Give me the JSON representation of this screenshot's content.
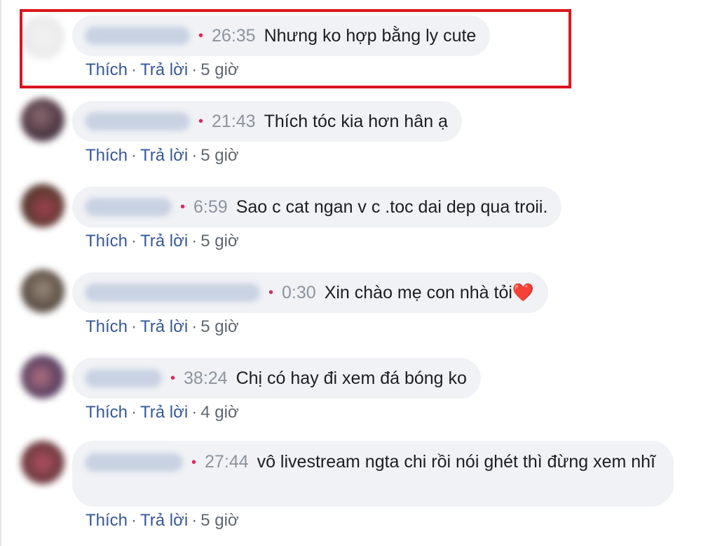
{
  "comments": [
    {
      "time": "26:35",
      "text": "Nhưng ko hợp bằng ly cute",
      "like": "Thích",
      "reply": "Trả lời",
      "age": "5 giờ"
    },
    {
      "time": "21:43",
      "text": "Thích tóc kia hơn hân ạ",
      "like": "Thích",
      "reply": "Trả lời",
      "age": "5 giờ"
    },
    {
      "time": "6:59",
      "text": "Sao c cat ngan v c .toc dai dep qua troii.",
      "like": "Thích",
      "reply": "Trả lời",
      "age": "5 giờ"
    },
    {
      "time": "0:30",
      "text": "Xin chào mẹ con nhà tỏi",
      "emoji": "❤️",
      "like": "Thích",
      "reply": "Trả lời",
      "age": "5 giờ"
    },
    {
      "time": "38:24",
      "text": "Chị có hay đi xem đá bóng ko",
      "like": "Thích",
      "reply": "Trả lời",
      "age": "4 giờ"
    },
    {
      "time": "27:44",
      "text": "vô livestream ngta chi rồi nói ghét thì đừng xem nhĩ",
      "like": "Thích",
      "reply": "Trả lời",
      "age": "5 giờ"
    }
  ],
  "separator": "·",
  "colors": {
    "highlight_border": "#d9161e",
    "link": "#365899",
    "bubble": "#f0f2f5",
    "timestamp": "#8d949e"
  }
}
